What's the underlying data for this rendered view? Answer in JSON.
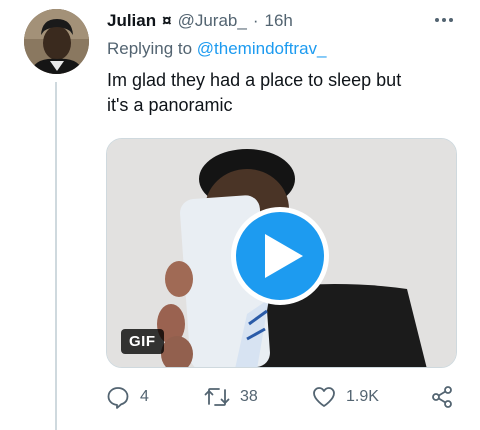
{
  "tweet": {
    "display_name": "Julian",
    "name_symbol": "¤",
    "handle": "@Jurab_",
    "separator": "·",
    "timestamp": "16h",
    "replying_prefix": "Replying to",
    "replying_to": "@themindoftrav_",
    "text": "Im glad they had a place to sleep but\nit's  a panoramic",
    "media": {
      "badge": "GIF"
    },
    "actions": {
      "reply_count": "4",
      "retweet_count": "38",
      "like_count": "1.9K"
    }
  },
  "icons": {
    "more": "more-dots-icon",
    "reply": "reply-icon",
    "retweet": "retweet-icon",
    "like": "heart-icon",
    "share": "share-icon",
    "play": "play-icon"
  },
  "colors": {
    "accent": "#1d9bf0",
    "secondary_text": "#536471",
    "primary_text": "#0f1419"
  }
}
